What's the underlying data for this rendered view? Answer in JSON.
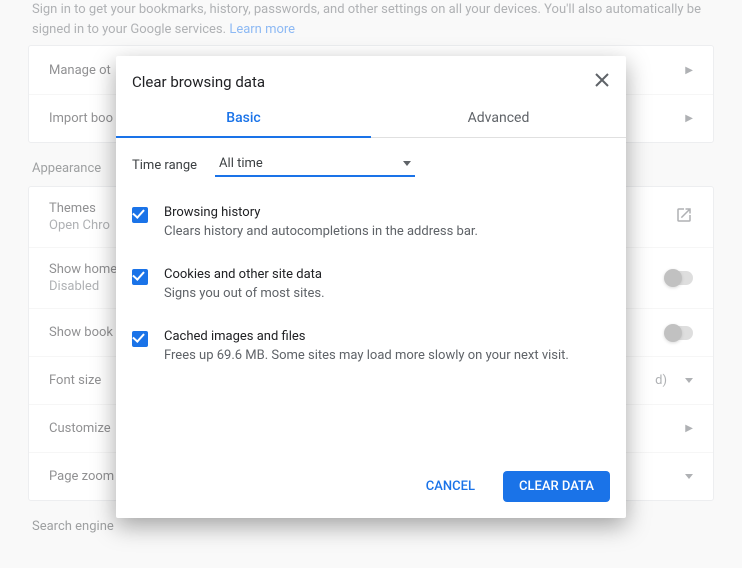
{
  "background": {
    "desc": "Sign in to get your bookmarks, history, passwords, and other settings on all your devices. You'll also automatically be signed in to your Google services.",
    "learn_more": "Learn more",
    "panel1": {
      "manage": "Manage ot",
      "import": "Import boo"
    },
    "appearance_h": "Appearance",
    "appearance": {
      "themes": {
        "title": "Themes",
        "sub": "Open Chro"
      },
      "show_home": {
        "title": "Show home",
        "sub": "Disabled"
      },
      "show_book": "Show book",
      "font_size": {
        "title": "Font size",
        "trail": "d)"
      },
      "customize": "Customize",
      "page_zoom": "Page zoom"
    },
    "search_h": "Search engine"
  },
  "dialog": {
    "title": "Clear browsing data",
    "tabs": {
      "basic": "Basic",
      "advanced": "Advanced"
    },
    "time_range_label": "Time range",
    "time_range_value": "All time",
    "options": [
      {
        "title": "Browsing history",
        "desc": "Clears history and autocompletions in the address bar."
      },
      {
        "title": "Cookies and other site data",
        "desc": "Signs you out of most sites."
      },
      {
        "title": "Cached images and files",
        "desc": "Frees up 69.6 MB. Some sites may load more slowly on your next visit."
      }
    ],
    "cancel": "CANCEL",
    "clear": "CLEAR DATA"
  }
}
